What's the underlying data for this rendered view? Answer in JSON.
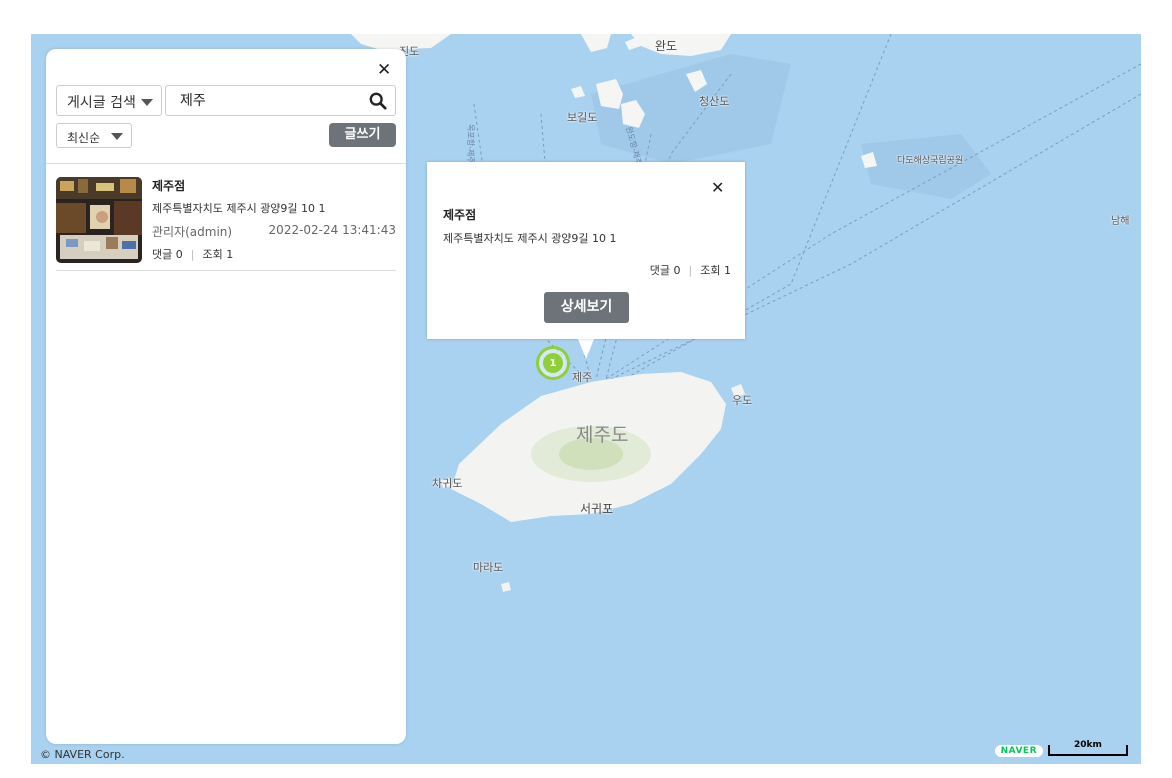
{
  "map": {
    "labels": {
      "jindo": "진도",
      "wando": "완도",
      "bogildo": "보길도",
      "cheongsando": "청산도",
      "dadohae": "다도해상국립공원",
      "namhae": "남해",
      "jeju_city": "제주",
      "jejudo": "제주도",
      "udo": "우도",
      "chagwido": "차귀도",
      "seogwipo": "서귀포",
      "marado": "마라도"
    },
    "route_labels": [
      "목포항-제주도",
      "완도항-제주도"
    ],
    "copyright": "© NAVER Corp.",
    "naver_logo": "NAVER",
    "scale_label": "20km",
    "marker_count": "1",
    "colors": {
      "sea": "#a9d1f0",
      "land": "#f5f6f4",
      "marker": "#8fcf3a"
    }
  },
  "panel": {
    "close_icon": "✕",
    "search_type": "게시글 검색",
    "search_value": "제주",
    "sort": "최신순",
    "write_button": "글쓰기",
    "items": [
      {
        "title": "제주점",
        "address": "제주특별자치도 제주시 광양9길 10 1",
        "author": "관리자(admin)",
        "date": "2022-02-24 13:41:43",
        "comments": "댓글 0",
        "views": "조회 1"
      }
    ]
  },
  "popup": {
    "close_icon": "✕",
    "title": "제주점",
    "address": "제주특별자치도 제주시 광양9길 10 1",
    "comments": "댓글 0",
    "views": "조회 1",
    "detail_button": "상세보기"
  },
  "separator": "|"
}
